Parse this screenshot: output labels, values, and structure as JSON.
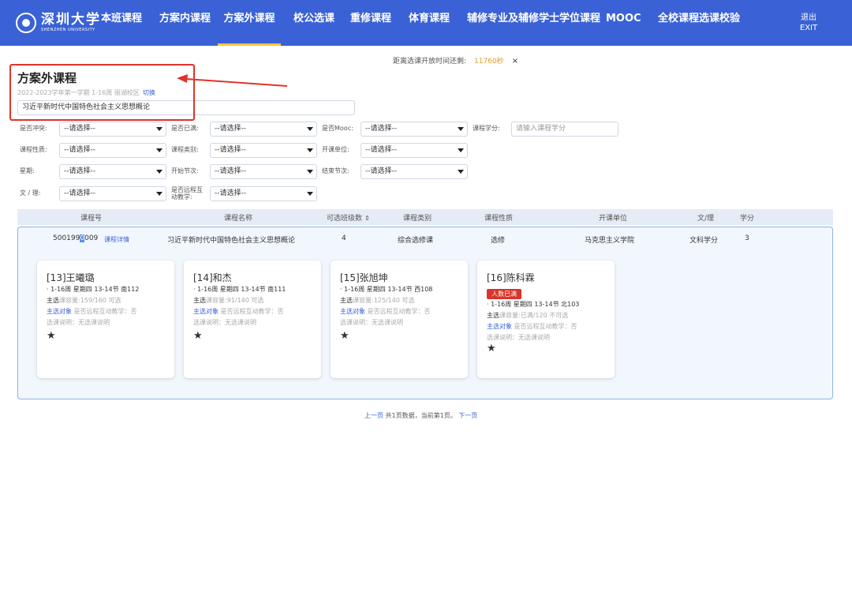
{
  "nav": {
    "logo_cn": "深圳大学",
    "logo_en": "SHENZHEN UNIVERSITY",
    "items": [
      {
        "label": "本班课程"
      },
      {
        "label": "方案内课程"
      },
      {
        "label": "方案外课程"
      },
      {
        "label": "校公选课"
      },
      {
        "label": "重修课程"
      },
      {
        "label": "体育课程"
      },
      {
        "label": "辅修专业及辅修学士学位课程"
      },
      {
        "label": "MOOC"
      },
      {
        "label": "全校课程选课校验"
      }
    ],
    "active_index": 2,
    "exit_cn": "退出",
    "exit_en": "EXIT"
  },
  "countdown": {
    "label": "距离选课开放时间还剩:",
    "seconds": "11760秒",
    "close": "×"
  },
  "header": {
    "title": "方案外课程",
    "term": "2022-2023学年第一学期 1-16周 丽湖校区",
    "switch": "切换",
    "search_value": "习近平新时代中国特色社会主义思想概论"
  },
  "filters": {
    "conflict": {
      "label": "是否冲突:",
      "value": "--请选择--"
    },
    "full": {
      "label": "是否已满:",
      "value": "--请选择--"
    },
    "mooc": {
      "label": "是否Mooc:",
      "value": "--请选择--"
    },
    "credit": {
      "label": "课程学分:",
      "placeholder": "请输入课程学分"
    },
    "nature": {
      "label": "课程性质:",
      "value": "--请选择--"
    },
    "category": {
      "label": "课程类别:",
      "value": "--请选择--"
    },
    "unit": {
      "label": "开课单位:",
      "value": "--请选择--"
    },
    "weekday": {
      "label": "星期:",
      "value": "--请选择--"
    },
    "start": {
      "label": "开始节次:",
      "value": "--请选择--"
    },
    "end": {
      "label": "结束节次:",
      "value": "--请选择--"
    },
    "arts": {
      "label": "文 / 理:",
      "value": "--请选择--"
    },
    "remote": {
      "label": "是否远程互动教学:",
      "value": "--请选择--"
    }
  },
  "table": {
    "headers": [
      "课程号",
      "课程名称",
      "可选班级数",
      "课程类别",
      "课程性质",
      "开课单位",
      "文/理",
      "学分"
    ],
    "sort_icon": "⇕",
    "row": {
      "code_prefix": "500199",
      "code_hl": "0",
      "code_suffix": "009",
      "detail": "课程详情",
      "name": "习近平新时代中国特色社会主义思想概论",
      "classes": "4",
      "category": "综合选修课",
      "nature": "选修",
      "unit": "马克思主义学院",
      "arts": "文科学分",
      "credit": "3"
    }
  },
  "cards": [
    {
      "title": "[13]王曦璐",
      "time": "· 1-16周 星期四 13-14节 南112",
      "main": "主选",
      "capacity": "课容量:159/160 可选",
      "target": "主选对象",
      "remote": "是否远程互动教学：否",
      "note": "选课说明：无选课说明"
    },
    {
      "title": "[14]和杰",
      "time": "· 1-16周 星期四 13-14节 南111",
      "main": "主选",
      "capacity": "课容量:91/140 可选",
      "target": "主选对象",
      "remote": "是否远程互动教学：否",
      "note": "选课说明：无选课说明"
    },
    {
      "title": "[15]张旭坤",
      "time": "· 1-16周 星期四 13-14节 西108",
      "main": "主选",
      "capacity": "课容量:125/140 可选",
      "target": "主选对象",
      "remote": "是否远程互动教学：否",
      "note": "选课说明：无选课说明"
    },
    {
      "title": "[16]陈科霖",
      "badge": "人数已满",
      "time": "· 1-16周 星期四 13-14节 北103",
      "main": "主选",
      "capacity": "课容量:已满/120 不可选",
      "target": "主选对象",
      "remote": "是否远程互动教学：否",
      "note": "选课说明：无选课说明"
    }
  ],
  "star_glyph": "★",
  "pager": {
    "prev": "上一页",
    "summary": "共1页数据，当前第1页。",
    "next": "下一页"
  },
  "colors": {
    "nav_bg": "#3a62d6",
    "active_underline": "#f5c63c",
    "annotation": "#e0332b",
    "full_badge": "#d9342a"
  }
}
